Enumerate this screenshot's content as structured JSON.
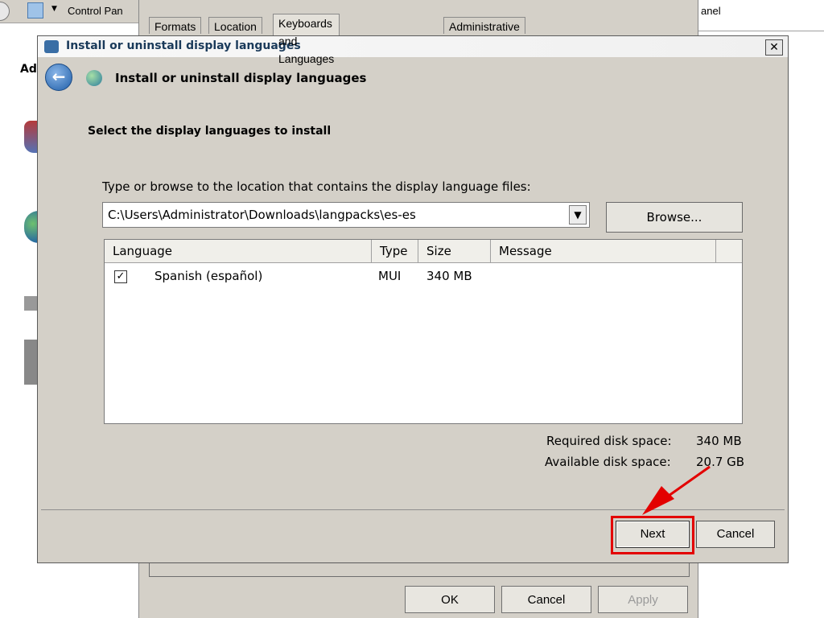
{
  "background": {
    "address_text": "Control Pan",
    "right_field_text": "anel",
    "sidebar_title": "Ad"
  },
  "region_dialog": {
    "tabs": [
      "Formats",
      "Location",
      "Keyboards and Languages",
      "Administrative"
    ],
    "buttons": {
      "ok": "OK",
      "cancel": "Cancel",
      "apply": "Apply"
    }
  },
  "dialog": {
    "title": "Install or uninstall display languages",
    "close_glyph": "✕",
    "header": {
      "back_glyph": "←",
      "title": "Install or uninstall display languages"
    },
    "content": {
      "heading": "Select the display languages to install",
      "path_label": "Type or browse to the location that contains the display language files:",
      "path_value": "C:\\Users\\Administrator\\Downloads\\langpacks\\es-es",
      "browse_label": "Browse...",
      "list": {
        "columns": [
          "Language",
          "Type",
          "Size",
          "Message"
        ],
        "rows": [
          {
            "checked_glyph": "✓",
            "language": "Spanish (español)",
            "type": "MUI",
            "size": "340 MB",
            "message": ""
          }
        ]
      },
      "required_label": "Required disk space:",
      "required_value": "340 MB",
      "available_label": "Available disk space:",
      "available_value": "20.7 GB"
    },
    "footer": {
      "next_label": "Next",
      "cancel_label": "Cancel"
    }
  },
  "annotation_color": "#e30000"
}
